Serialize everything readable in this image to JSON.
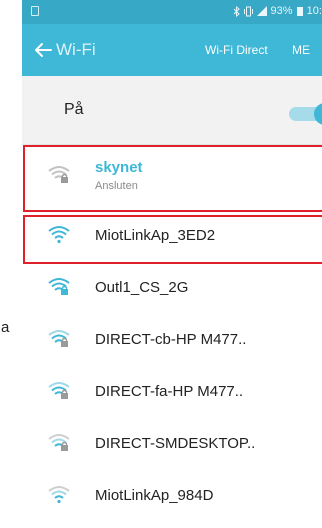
{
  "side_text": "a",
  "status_bar": {
    "battery_percent": "93%",
    "time": "10:5",
    "icons": [
      "sim-icon",
      "bluetooth-icon",
      "vibrate-icon",
      "signal-icon",
      "battery-icon"
    ]
  },
  "app_bar": {
    "title": "Wi-Fi",
    "wifi_direct_label": "Wi-Fi Direct",
    "more_label": "ME",
    "accent": "#3fb7d6"
  },
  "wifi_toggle": {
    "label": "På",
    "state": "on"
  },
  "networks": [
    {
      "name": "skynet",
      "status": "Ansluten",
      "icon": "wifi-lock-icon"
    },
    {
      "name": "MiotLinkAp_3ED2",
      "status": "",
      "icon": "wifi-icon"
    },
    {
      "name": "Outl1_CS_2G",
      "status": "",
      "icon": "wifi-lock-icon"
    },
    {
      "name": "DIRECT-cb-HP M477..",
      "status": "",
      "icon": "wifi-lock-icon"
    },
    {
      "name": "DIRECT-fa-HP M477..",
      "status": "",
      "icon": "wifi-lock-icon"
    },
    {
      "name": "DIRECT-SMDESKTOP..",
      "status": "",
      "icon": "wifi-lock-icon"
    },
    {
      "name": "MiotLinkAp_984D",
      "status": "",
      "icon": "wifi-icon"
    }
  ]
}
